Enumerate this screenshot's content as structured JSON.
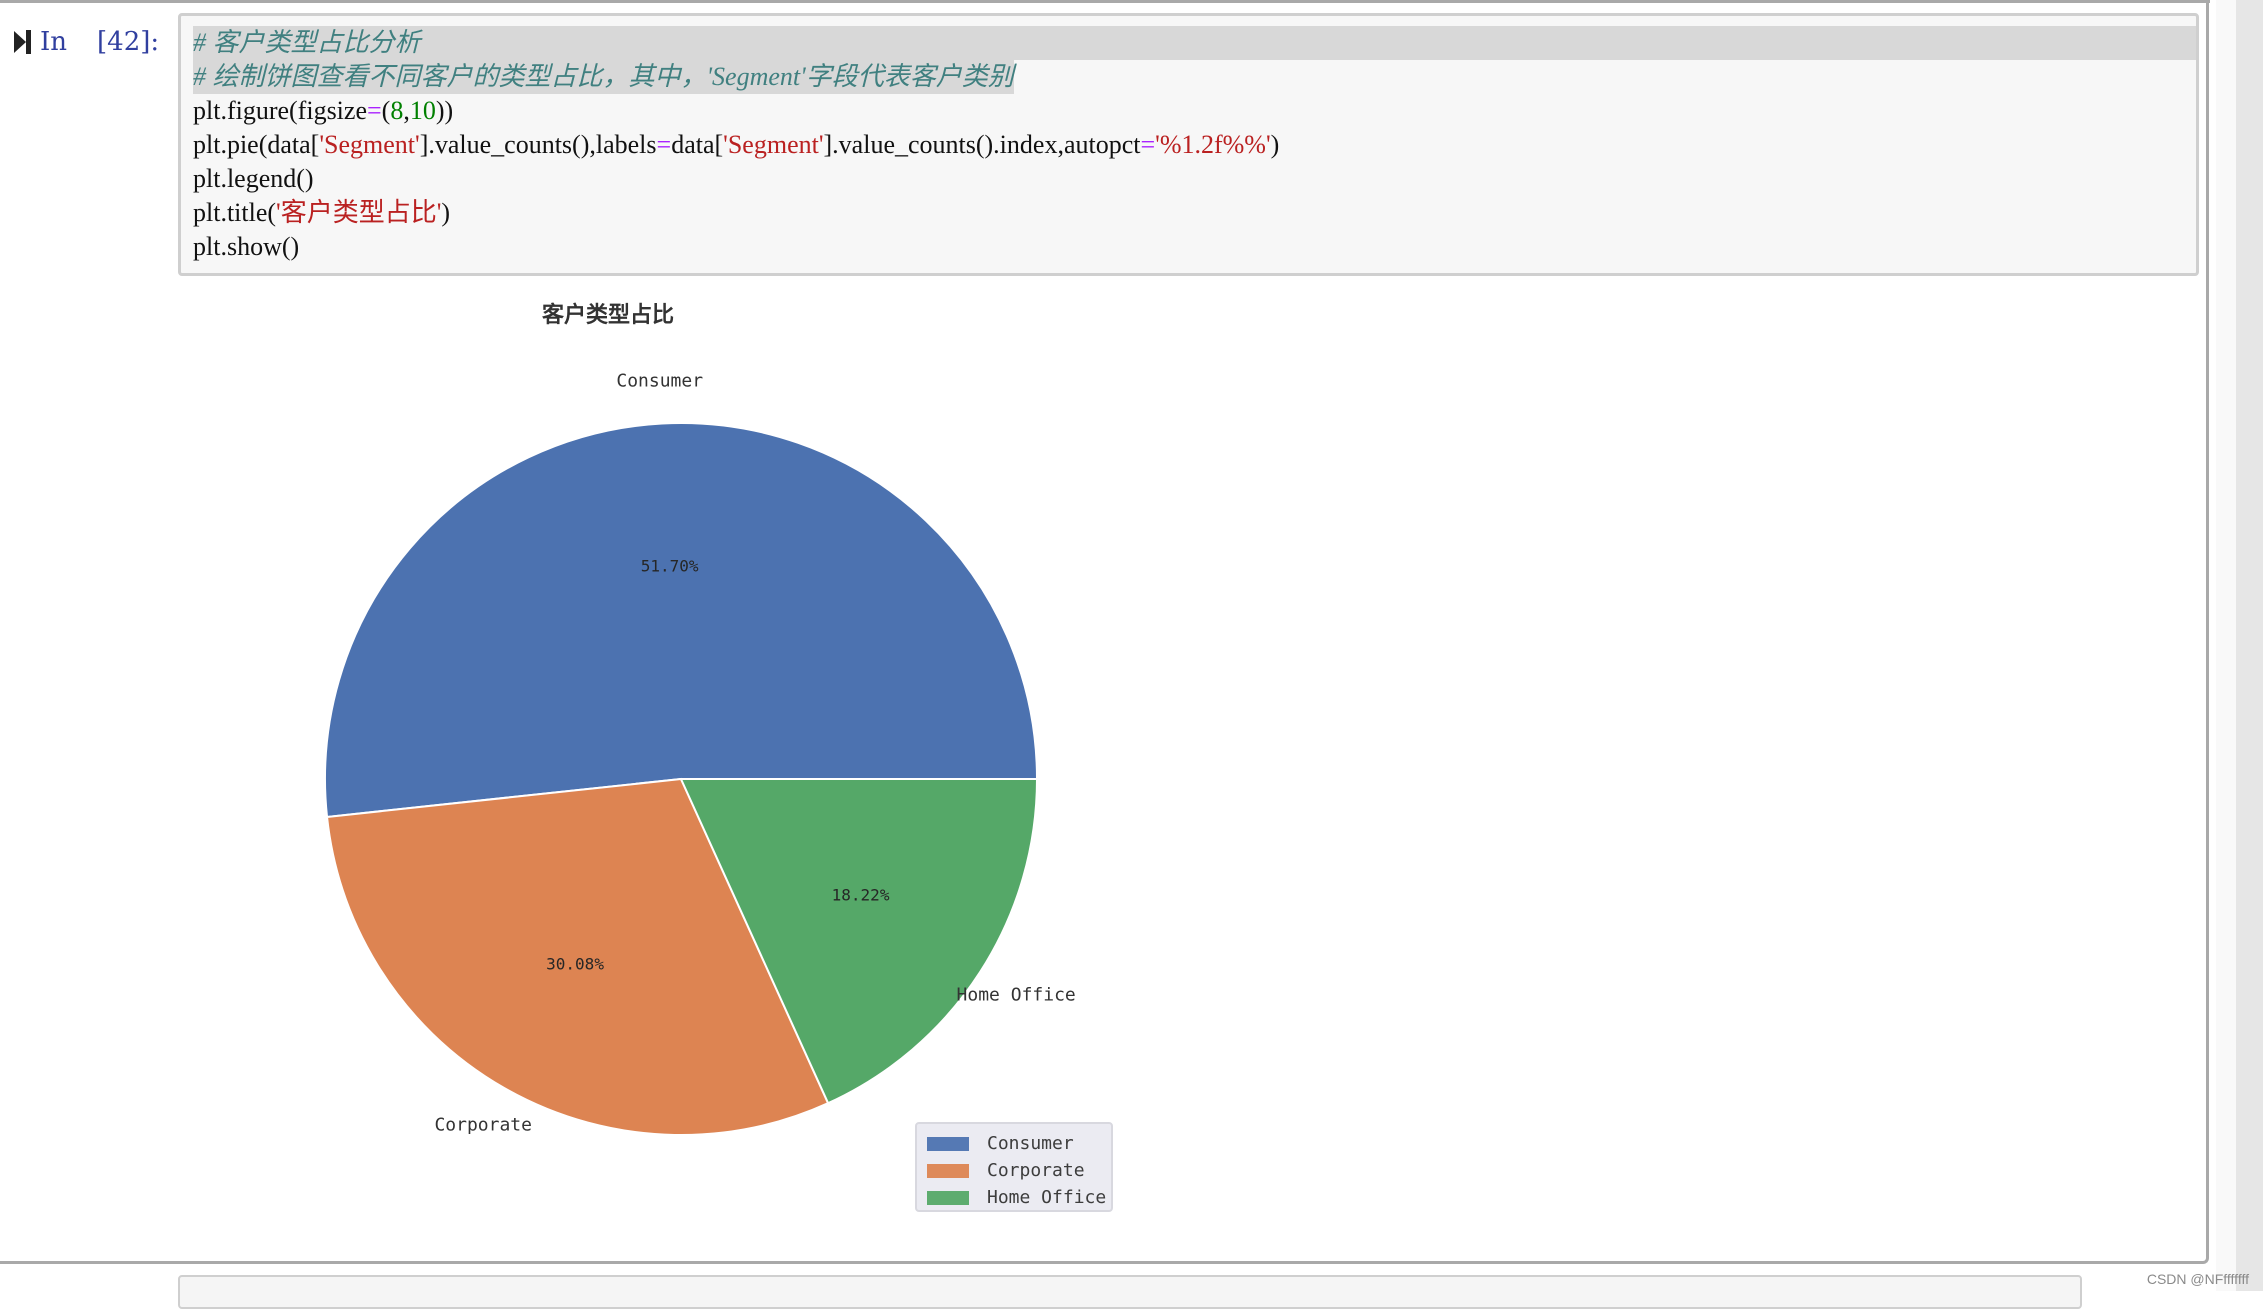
{
  "cell": {
    "prompt_label": "In",
    "execution_count": "[42]:",
    "code_lines": [
      {
        "parts": [
          {
            "t": "# 客户类型占比分析",
            "c": "cmt"
          }
        ]
      },
      {
        "parts": [
          {
            "t": "# 绘制饼图查看不同客户的类型占比，其中，'Segment'字段代表客户类别",
            "c": "cmt"
          }
        ]
      },
      {
        "parts": [
          {
            "t": "plt.figure(figsize",
            "c": ""
          },
          {
            "t": "=",
            "c": "o"
          },
          {
            "t": "(",
            "c": ""
          },
          {
            "t": "8",
            "c": "n"
          },
          {
            "t": ",",
            "c": ""
          },
          {
            "t": "10",
            "c": "n"
          },
          {
            "t": "))",
            "c": ""
          }
        ]
      },
      {
        "parts": [
          {
            "t": "plt.pie(data[",
            "c": ""
          },
          {
            "t": "'Segment'",
            "c": "s"
          },
          {
            "t": "].value_counts(),labels",
            "c": ""
          },
          {
            "t": "=",
            "c": "o"
          },
          {
            "t": "data[",
            "c": ""
          },
          {
            "t": "'Segment'",
            "c": "s"
          },
          {
            "t": "].value_counts().index,autopct",
            "c": ""
          },
          {
            "t": "=",
            "c": "o"
          },
          {
            "t": "'%1.2f%%'",
            "c": "s"
          },
          {
            "t": ")",
            "c": ""
          }
        ]
      },
      {
        "parts": [
          {
            "t": "plt.legend()",
            "c": ""
          }
        ]
      },
      {
        "parts": [
          {
            "t": "plt.title(",
            "c": ""
          },
          {
            "t": "'客户类型占比'",
            "c": "s"
          },
          {
            "t": ")",
            "c": ""
          }
        ]
      },
      {
        "parts": [
          {
            "t": "plt.show()",
            "c": ""
          }
        ]
      }
    ]
  },
  "chart_data": {
    "type": "pie",
    "title": "客户类型占比",
    "categories": [
      "Consumer",
      "Corporate",
      "Home Office"
    ],
    "values": [
      51.7,
      30.08,
      18.22
    ],
    "value_labels": [
      "51.70%",
      "30.08%",
      "18.22%"
    ],
    "colors": [
      "#4c72b0",
      "#dd8452",
      "#55a868"
    ],
    "start_angle_deg": 0,
    "direction": "counterclockwise",
    "legend": {
      "placement": "lower-right-of-pie",
      "entries": [
        "Consumer",
        "Corporate",
        "Home Office"
      ]
    }
  },
  "watermark": "CSDN @NFfffffff"
}
